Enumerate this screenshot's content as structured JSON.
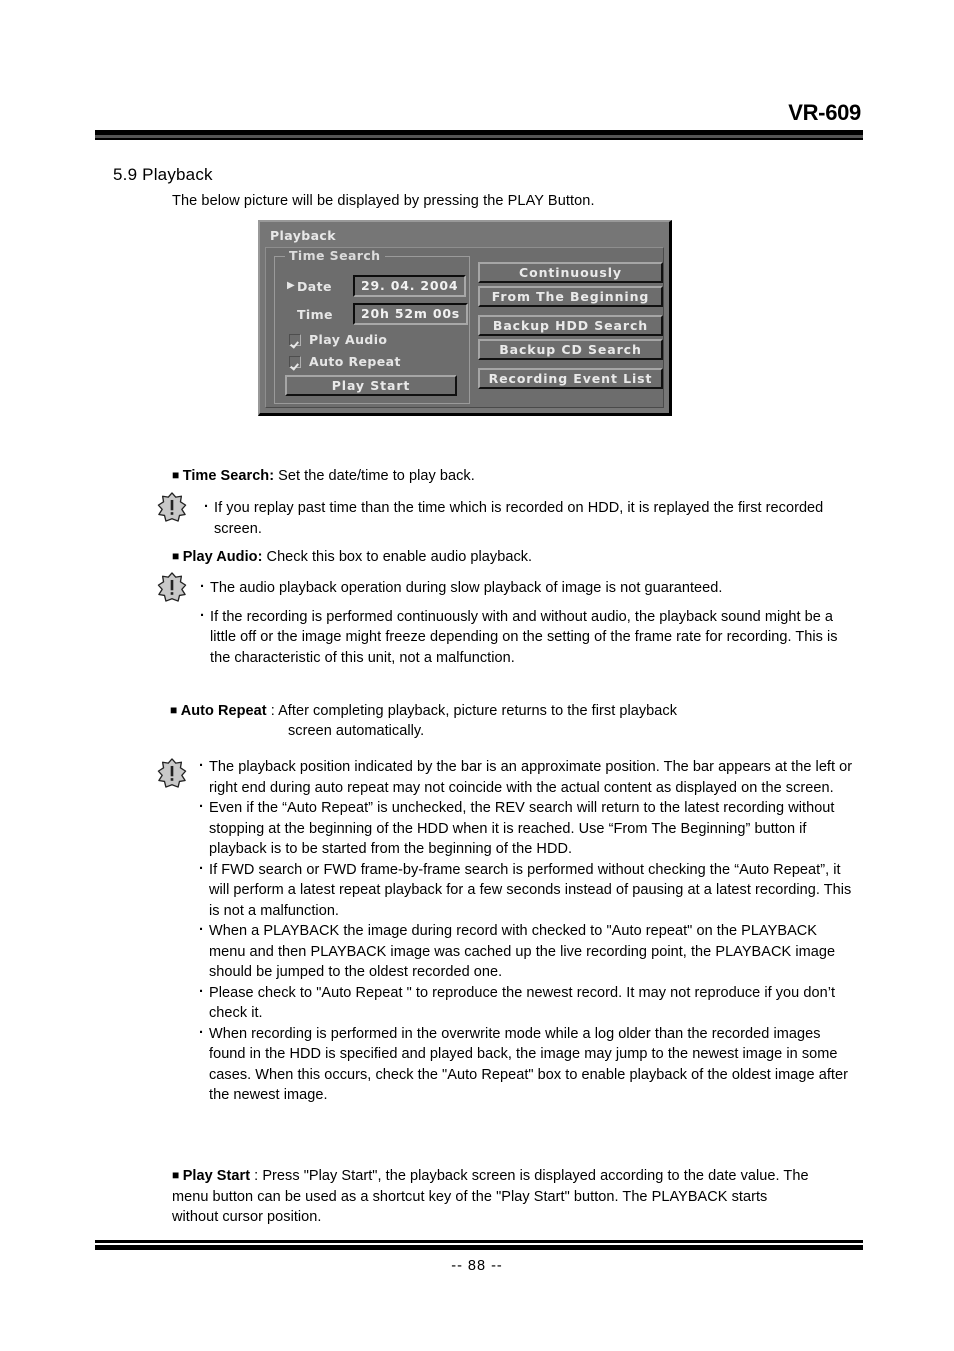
{
  "header": {
    "model": "VR-609"
  },
  "section": {
    "heading": "5.9 Playback",
    "intro": "The below picture will be displayed by pressing the PLAY Button."
  },
  "dialog": {
    "title": "Playback",
    "group_legend": "Time Search",
    "fields": [
      {
        "label": "Date",
        "value": "29. 04. 2004",
        "cursor": true
      },
      {
        "label": "Time",
        "value": "20h 52m 00s",
        "cursor": false
      }
    ],
    "checkboxes": [
      {
        "label": "Play Audio",
        "checked": true
      },
      {
        "label": "Auto Repeat",
        "checked": true
      }
    ],
    "play_start_label": "Play Start",
    "right_buttons": [
      "Continuously",
      "From The Beginning",
      "Backup HDD Search",
      "Backup CD Search",
      "Recording Event List"
    ]
  },
  "content": {
    "time_search_term": "Time Search:",
    "time_search_desc": " Set the date/time to play back.",
    "note1": "If you replay past time than the time which is recorded on HDD, it is replayed the first recorded screen.",
    "play_audio_term": "Play Audio:",
    "play_audio_desc": " Check this box to enable audio playback.",
    "note2_a": "The audio playback operation during slow playback of image is not guaranteed.",
    "note2_b": "If the recording is performed continuously with and without audio, the playback sound might be a little off or the image might freeze depending on the setting of the frame rate for recording. This is the characteristic of this unit, not a malfunction.",
    "auto_repeat_term": "Auto Repeat",
    "auto_repeat_desc": " : After completing playback, picture returns to the first playback",
    "auto_repeat_desc2": "screen automatically.",
    "note3_a": "The playback position indicated by the bar is an approximate position. The bar appears at the left or right end during auto repeat may not coincide with the actual content as displayed on the screen.",
    "note3_b": "Even if the “Auto Repeat” is unchecked, the REV search will return to the latest recording without stopping at the beginning of the HDD when it is reached. Use “From The Beginning” button if playback is to be started from the beginning of the HDD.",
    "note3_c": "If FWD search or FWD frame-by-frame search is performed without checking the “Auto Repeat”, it will perform a latest repeat playback for a few seconds instead of pausing at a latest recording. This is not a malfunction.",
    "note3_d": "When a PLAYBACK the image during record with checked to \"Auto repeat\" on the PLAYBACK menu and then PLAYBACK image was cached up the live recording point, the PLAYBACK image should be jumped to the oldest recorded one.",
    "note3_e": "Please check to \"Auto Repeat \" to reproduce the newest record. It may not reproduce if you don’t check it.",
    "note3_f": "When recording is performed in the overwrite mode while a log older than the recorded images found in the HDD is specified and played back, the image may jump to the newest image in some cases. When this occurs, check the \"Auto Repeat\" box to enable playback of the oldest image after the newest image.",
    "play_start_term": "Play Start",
    "play_start_desc": " : Press \"Play Start\", the playback screen is displayed according to the date value. The menu button can be used as a shortcut key of the \"Play Start\" button. The PLAYBACK starts without cursor position."
  },
  "footer": {
    "page_number": "-- 88 --"
  }
}
